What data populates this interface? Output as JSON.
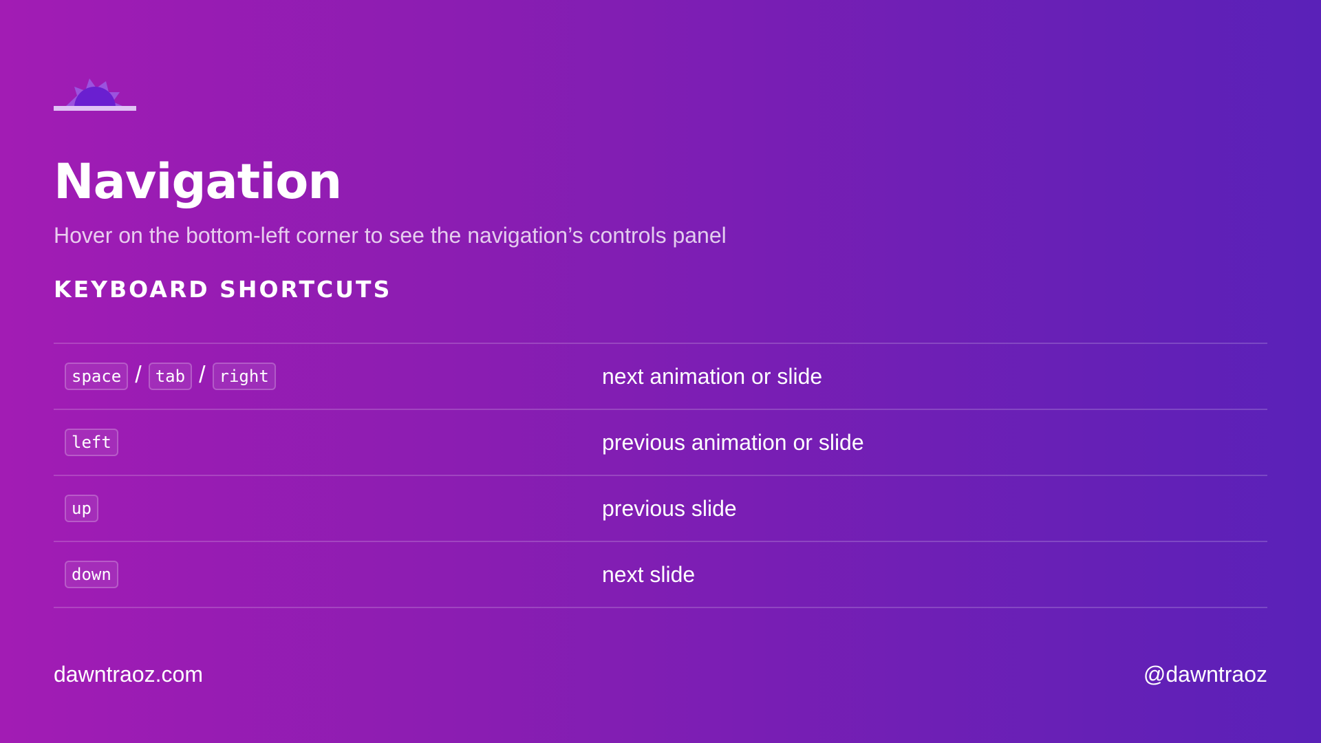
{
  "logo": {
    "icon": "sunrise-logo-icon"
  },
  "title": "Navigation",
  "subtitle": "Hover on the bottom-left corner to see the navigation’s controls panel",
  "section_heading": "KEYBOARD SHORTCUTS",
  "shortcuts": [
    {
      "keys": [
        "space",
        "tab",
        "right"
      ],
      "separator": "/",
      "description": "next animation or slide"
    },
    {
      "keys": [
        "left"
      ],
      "description": "previous animation or slide"
    },
    {
      "keys": [
        "up"
      ],
      "description": "previous slide"
    },
    {
      "keys": [
        "down"
      ],
      "description": "next slide"
    }
  ],
  "footer": {
    "website": "dawntraoz.com",
    "handle": "@dawntraoz"
  },
  "colors": {
    "gradient_start": "#a21cb4",
    "gradient_end": "#5a21b8",
    "logo_petal": "#9b5de5",
    "logo_sun": "#6a1fd0",
    "logo_bar": "#e0c3f5"
  }
}
